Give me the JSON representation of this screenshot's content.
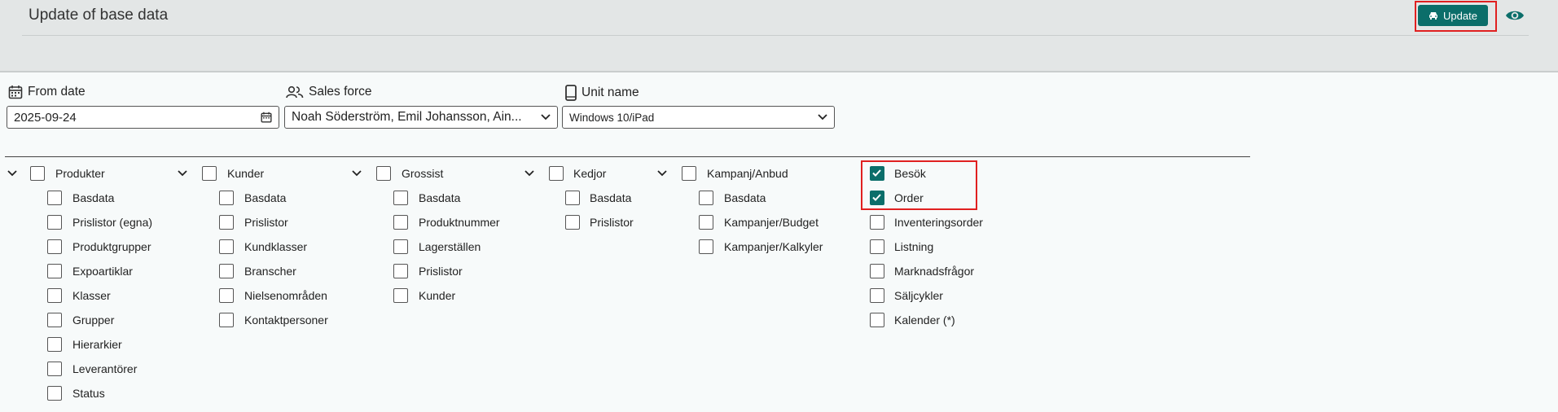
{
  "header": {
    "title": "Update of base data",
    "update_label": "Update"
  },
  "filters": {
    "from_date": {
      "label": "From date",
      "value": "2025-09-24"
    },
    "sales_force": {
      "label": "Sales force",
      "value": "Noah Söderström, Emil Johansson, Ain..."
    },
    "unit_name": {
      "label": "Unit name",
      "value": "Windows 10/iPad"
    }
  },
  "groups": {
    "produkter": {
      "label": "Produkter",
      "checked": false,
      "items": [
        {
          "label": "Basdata",
          "checked": false
        },
        {
          "label": "Prislistor (egna)",
          "checked": false
        },
        {
          "label": "Produktgrupper",
          "checked": false
        },
        {
          "label": "Expoartiklar",
          "checked": false
        },
        {
          "label": "Klasser",
          "checked": false
        },
        {
          "label": "Grupper",
          "checked": false
        },
        {
          "label": "Hierarkier",
          "checked": false
        },
        {
          "label": "Leverantörer",
          "checked": false
        },
        {
          "label": "Status",
          "checked": false
        }
      ]
    },
    "kunder": {
      "label": "Kunder",
      "checked": false,
      "items": [
        {
          "label": "Basdata",
          "checked": false
        },
        {
          "label": "Prislistor",
          "checked": false
        },
        {
          "label": "Kundklasser",
          "checked": false
        },
        {
          "label": "Branscher",
          "checked": false
        },
        {
          "label": "Nielsenområden",
          "checked": false
        },
        {
          "label": "Kontaktpersoner",
          "checked": false
        }
      ]
    },
    "grossist": {
      "label": "Grossist",
      "checked": false,
      "items": [
        {
          "label": "Basdata",
          "checked": false
        },
        {
          "label": "Produktnummer",
          "checked": false
        },
        {
          "label": "Lagerställen",
          "checked": false
        },
        {
          "label": "Prislistor",
          "checked": false
        },
        {
          "label": "Kunder",
          "checked": false
        }
      ]
    },
    "kedjor": {
      "label": "Kedjor",
      "checked": false,
      "items": [
        {
          "label": "Basdata",
          "checked": false
        },
        {
          "label": "Prislistor",
          "checked": false
        }
      ]
    },
    "kampanj": {
      "label": "Kampanj/Anbud",
      "checked": false,
      "items": [
        {
          "label": "Basdata",
          "checked": false
        },
        {
          "label": "Kampanjer/Budget",
          "checked": false
        },
        {
          "label": "Kampanjer/Kalkyler",
          "checked": false
        }
      ]
    },
    "other": {
      "items": [
        {
          "label": "Besök",
          "checked": true
        },
        {
          "label": "Order",
          "checked": true
        },
        {
          "label": "Inventeringsorder",
          "checked": false
        },
        {
          "label": "Listning",
          "checked": false
        },
        {
          "label": "Marknadsfrågor",
          "checked": false
        },
        {
          "label": "Säljcykler",
          "checked": false
        },
        {
          "label": "Kalender (*)",
          "checked": false
        }
      ]
    }
  },
  "icons": {
    "update": "car-icon",
    "preview": "eye-icon",
    "date": "calendar-icon",
    "sales": "people-icon",
    "unit": "phone-icon",
    "expand": "chevron-down-icon"
  },
  "colors": {
    "accent": "#0b6e6a",
    "highlight": "#e02020",
    "header_bg": "#e3e6e6"
  }
}
